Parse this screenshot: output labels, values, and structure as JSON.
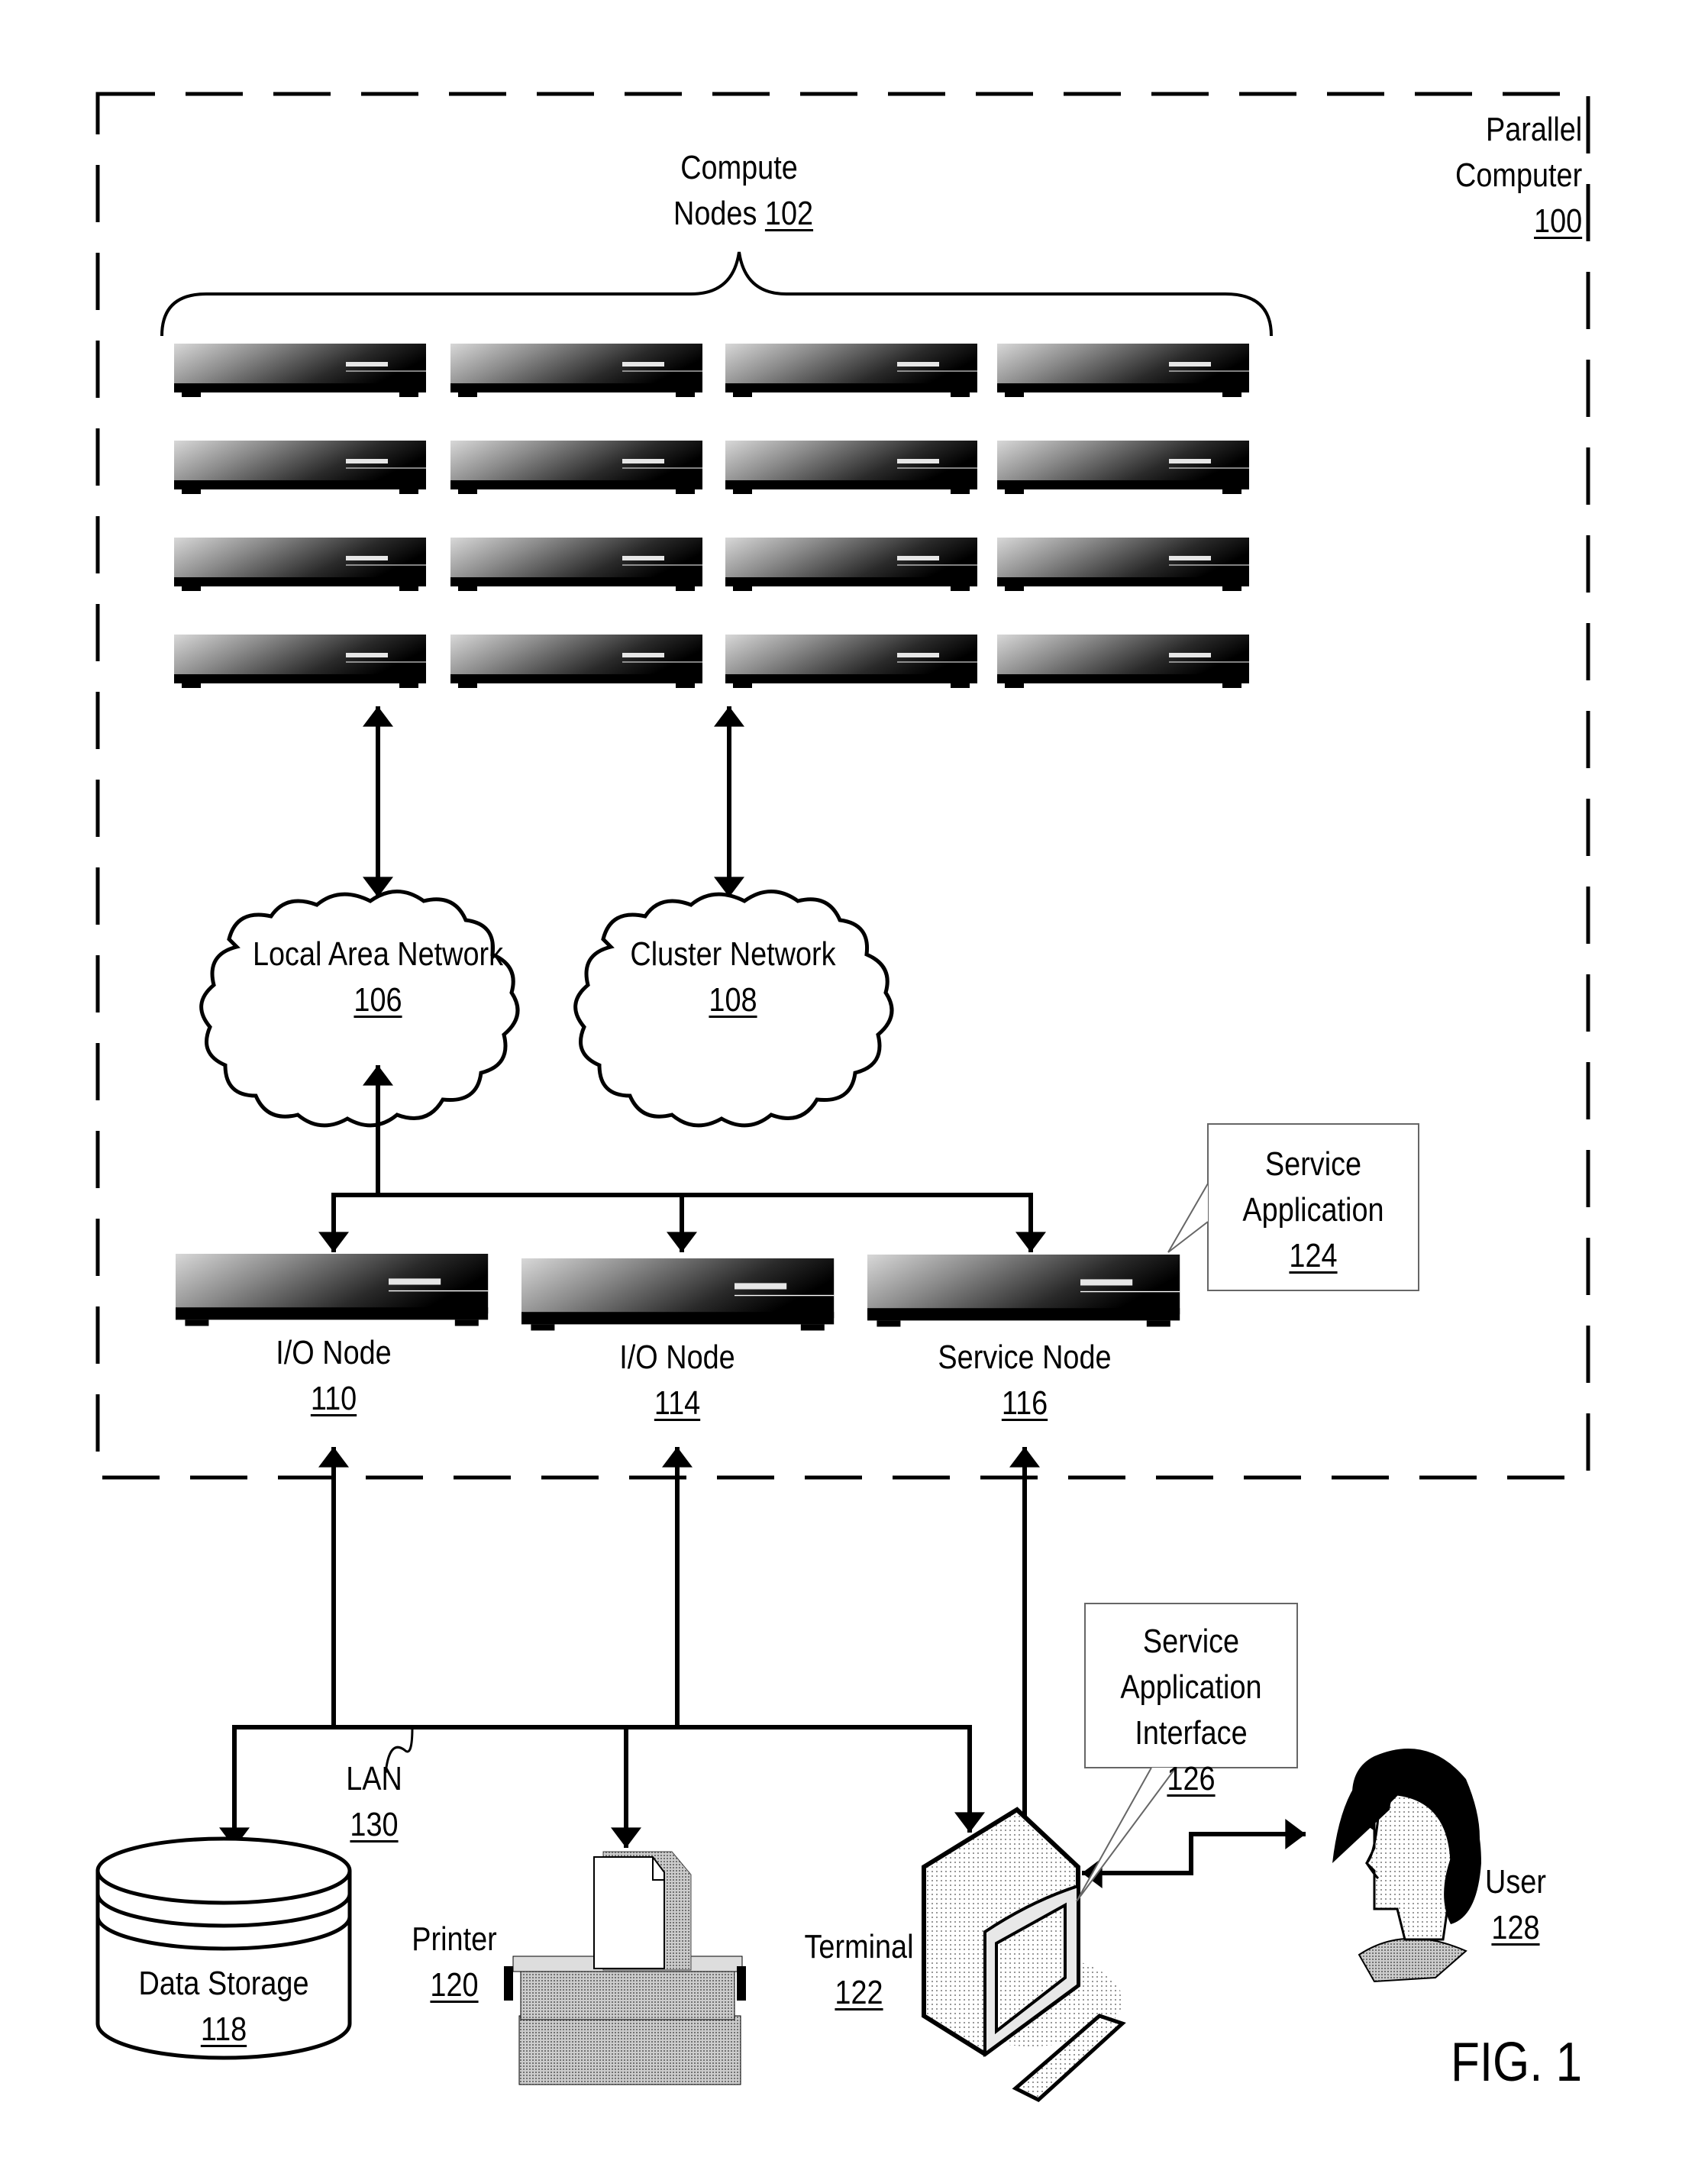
{
  "figure": {
    "label": "FIG. 1",
    "parallel_computer": {
      "line1": "Parallel",
      "line2": "Computer",
      "ref": "100"
    },
    "compute_nodes": {
      "line1": "Compute",
      "line2": "Nodes",
      "ref": "102",
      "grid_rows": 4,
      "grid_cols": 4
    },
    "networks": {
      "lan": {
        "label": "Local Area Network",
        "ref": "106"
      },
      "cluster": {
        "label": "Cluster Network",
        "ref": "108"
      }
    },
    "nodes": [
      {
        "label": "I/O Node",
        "ref": "110"
      },
      {
        "label": "I/O Node",
        "ref": "114"
      },
      {
        "label": "Service Node",
        "ref": "116"
      }
    ],
    "service_application": {
      "line1": "Service",
      "line2": "Application",
      "ref": "124"
    },
    "service_application_interface": {
      "line1": "Service",
      "line2": "Application",
      "line3": "Interface",
      "ref": "126"
    },
    "lan_bus": {
      "label": "LAN",
      "ref": "130"
    },
    "devices": {
      "data_storage": {
        "label": "Data Storage",
        "ref": "118"
      },
      "printer": {
        "label": "Printer",
        "ref": "120"
      },
      "terminal": {
        "label": "Terminal",
        "ref": "122"
      },
      "user": {
        "label": "User",
        "ref": "128"
      }
    }
  }
}
